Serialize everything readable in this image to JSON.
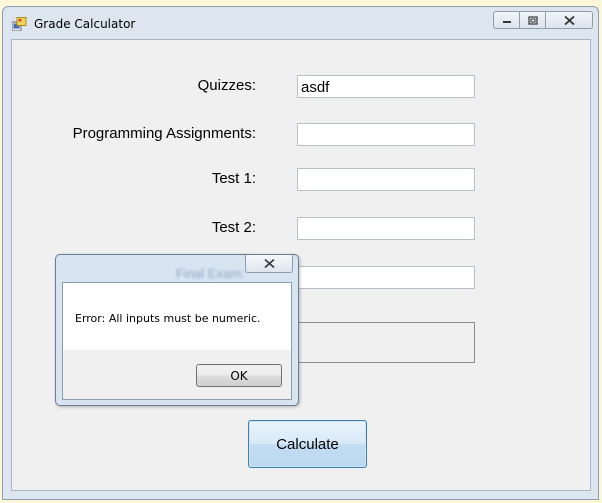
{
  "window": {
    "title": "Grade Calculator",
    "buttons": {
      "minimize": "—",
      "maximize": "□",
      "close": "✕"
    }
  },
  "form": {
    "fields": [
      {
        "label": "Quizzes:",
        "value": "asdf"
      },
      {
        "label": "Programming Assignments:",
        "value": ""
      },
      {
        "label": "Test 1:",
        "value": ""
      },
      {
        "label": "Test 2:",
        "value": ""
      },
      {
        "label": "Final Exam:",
        "value": ""
      }
    ],
    "calculate_label": "Calculate"
  },
  "dialog": {
    "message": "Error: All inputs must be numeric.",
    "ok_label": "OK",
    "close_glyph": "✕"
  }
}
